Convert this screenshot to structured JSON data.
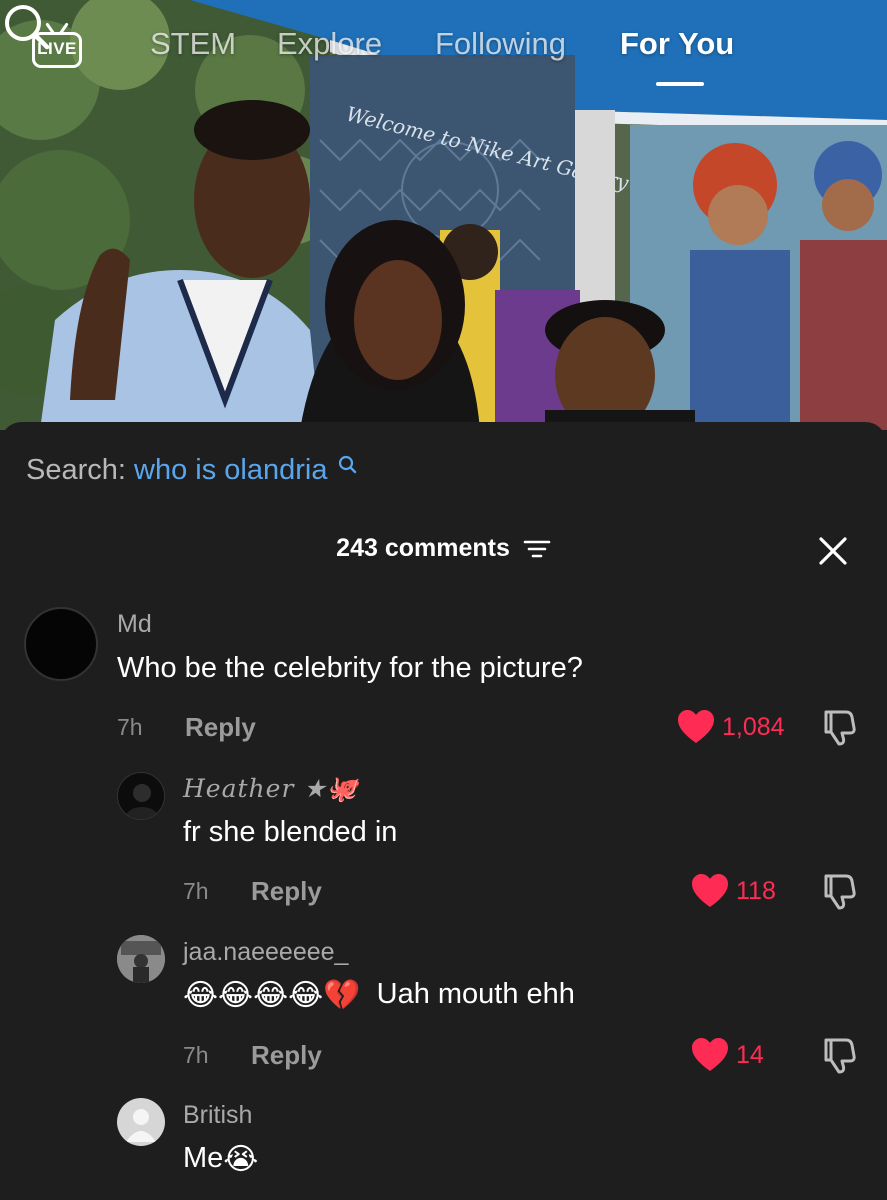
{
  "nav": {
    "live_label": "LIVE",
    "tabs": [
      {
        "label": "STEM"
      },
      {
        "label": "Explore"
      },
      {
        "label": "Following"
      },
      {
        "label": "For You"
      }
    ],
    "active_tab": "For You",
    "search_icon": "search-icon"
  },
  "video": {
    "signage_text": "Welcome to Nike Art Gallery"
  },
  "search_suggestion": {
    "label": "Search:",
    "query": "who is olandria"
  },
  "comments_header": {
    "count_text": "243 comments",
    "filter_icon": "filter-icon",
    "close_icon": "close-icon"
  },
  "colors": {
    "like": "#fe2c55",
    "link": "#5aa6ee",
    "panel_bg": "#1e1e1e"
  },
  "comments": [
    {
      "user": "Md",
      "text": "Who be the celebrity for the picture?",
      "time": "7h",
      "reply": "Reply",
      "likes": "1,084"
    },
    {
      "user": "Heather ★🐙",
      "text": "fr she blended in",
      "time": "7h",
      "reply": "Reply",
      "likes": "118"
    },
    {
      "user": "jaa.naeeeeee_",
      "text": "Uah mouth ehh",
      "emoji_prefix": "😂😂😂😂💔",
      "time": "7h",
      "reply": "Reply",
      "likes": "14"
    },
    {
      "user": "British",
      "text": "Me",
      "emoji_suffix": "😭"
    }
  ]
}
